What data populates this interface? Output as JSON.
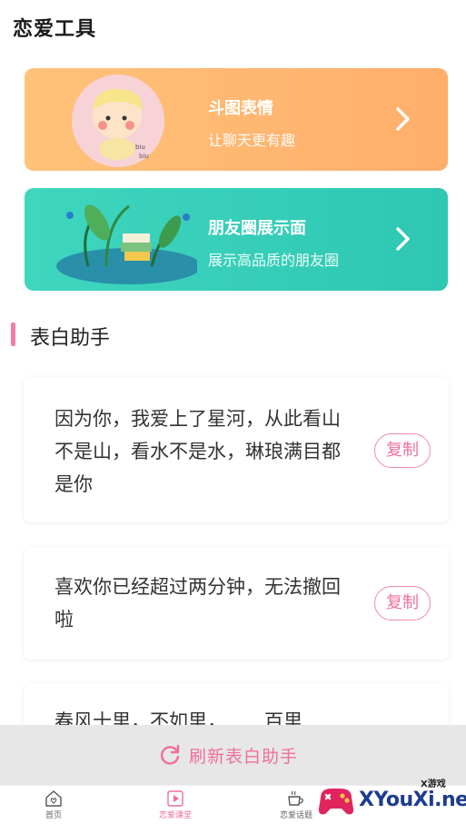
{
  "header": {
    "title": "恋爱工具"
  },
  "banners": [
    {
      "title": "斗图表情",
      "subtitle": "让聊天更有趣",
      "color": "#ffb473",
      "icon": "chevron-right-icon"
    },
    {
      "title": "朋友圈展示面",
      "subtitle": "展示高品质的朋友圈",
      "color": "#35cdb8",
      "icon": "chevron-right-icon"
    }
  ],
  "section": {
    "title": "表白助手",
    "accent": "#f27da6"
  },
  "cards": [
    {
      "text": "因为你，我爱上了星河，从此看山不是山，看水不是水，琳琅满目都是你",
      "copy_label": "复制"
    },
    {
      "text": "喜欢你已经超过两分钟，无法撤回啦",
      "copy_label": "复制"
    },
    {
      "text": "春风十里，不如里，……百里"
    }
  ],
  "refresh": {
    "label": "刷新表白助手",
    "icon": "refresh-icon"
  },
  "tabbar": {
    "items": [
      {
        "label": "首页",
        "icon": "heart-home-icon"
      },
      {
        "label": "恋爱课堂",
        "icon": "play-icon"
      },
      {
        "label": "恋爱话题",
        "icon": "cup-icon"
      }
    ]
  },
  "watermark": {
    "text": "XYouXi.net",
    "small": "X游戏"
  },
  "colors": {
    "accent": "#f06f9a",
    "orange": "#ffb473",
    "teal": "#35cdb8"
  }
}
